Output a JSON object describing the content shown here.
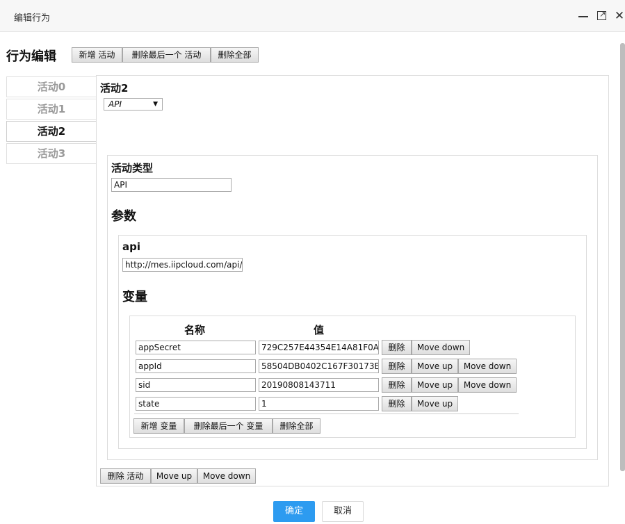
{
  "dialog": {
    "title": "编辑行为",
    "icons": [
      "minimize-icon",
      "maximize-icon",
      "close-icon"
    ],
    "close_glyph": "✕",
    "max_glyph": "↗"
  },
  "behavior": {
    "heading": "行为编辑",
    "add_activity": "新增 活动",
    "delete_last_activity": "删除最后一个 活动",
    "delete_all": "删除全部"
  },
  "tabs": [
    "活动0",
    "活动1",
    "活动2",
    "活动3"
  ],
  "activity": {
    "title": "活动2",
    "select_value": "API",
    "select_caret": "▼",
    "type_label": "活动类型",
    "type_value": "API",
    "params_heading": "参数",
    "api_label": "api",
    "api_value": "http://mes.iipcloud.com/api/d",
    "vars_heading": "变量",
    "delete_activity": "删除 活动",
    "move_up": "Move up",
    "move_down": "Move down"
  },
  "variables": {
    "col_name": "名称",
    "col_value": "值",
    "rows": [
      {
        "name": "appSecret",
        "value": "729C257E44354E14A81F0A"
      },
      {
        "name": "appId",
        "value": "58504DB0402C167F30173E"
      },
      {
        "name": "sid",
        "value": "20190808143711"
      },
      {
        "name": "state",
        "value": "1"
      }
    ],
    "delete": "删除",
    "move_up": "Move up",
    "move_down": "Move down",
    "add_var": "新增 变量",
    "delete_last_var": "删除最后一个 变量",
    "delete_all": "删除全部"
  },
  "footer": {
    "ok": "确定",
    "cancel": "取消"
  },
  "colors": {
    "primary": "#2d9bf0"
  }
}
